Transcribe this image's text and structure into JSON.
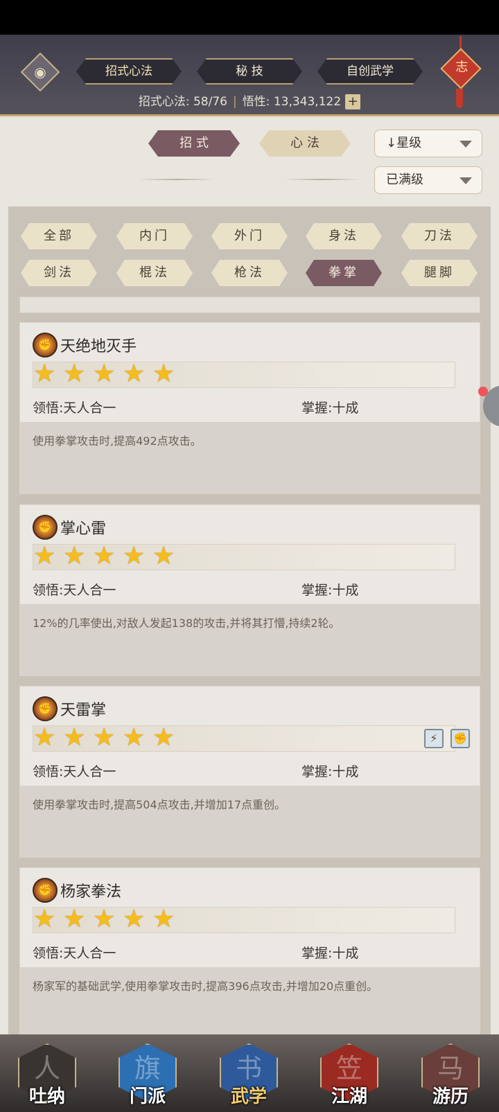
{
  "header": {
    "tabs": [
      {
        "label": "招式心法",
        "active": true
      },
      {
        "label": "秘 技",
        "active": false
      },
      {
        "label": "自创武学",
        "active": false
      }
    ],
    "stats": {
      "learned_label": "招式心法: 58/76",
      "insight_label": "悟性: 13,343,122"
    },
    "knot_char": "志"
  },
  "toggle": {
    "zhaoshi": "招 式",
    "xinfa": "心 法"
  },
  "sort": {
    "star_label": "↓星级",
    "filter_label": "已满级"
  },
  "filters": [
    "全部",
    "内门",
    "外门",
    "身法",
    "刀法",
    "剑法",
    "棍法",
    "枪法",
    "拳掌",
    "腿脚"
  ],
  "active_filter_index": 8,
  "cards": [
    {
      "name": "天绝地灭手",
      "stars": 5,
      "wu": "领悟:天人合一",
      "zhang": "掌握:十成",
      "desc": "使用拳掌攻击时,提高492点攻击。",
      "badges": []
    },
    {
      "name": "掌心雷",
      "stars": 5,
      "wu": "领悟:天人合一",
      "zhang": "掌握:十成",
      "desc": "12%的几率使出,对敌人发起138的攻击,并将其打懵,持续2轮。",
      "badges": []
    },
    {
      "name": "天雷掌",
      "stars": 5,
      "wu": "领悟:天人合一",
      "zhang": "掌握:十成",
      "desc": "使用拳掌攻击时,提高504点攻击,并增加17点重创。",
      "badges": [
        "⚡",
        "✊"
      ]
    },
    {
      "name": "杨家拳法",
      "stars": 5,
      "wu": "领悟:天人合一",
      "zhang": "掌握:十成",
      "desc": "杨家军的基础武学,使用拳掌攻击时,提高396点攻击,并增加20点重创。",
      "badges": []
    }
  ],
  "nav": [
    {
      "label": "吐纳",
      "icon": "meditate-icon",
      "glyph": "人",
      "color": "#3a3430",
      "active": false
    },
    {
      "label": "门派",
      "icon": "sect-icon",
      "glyph": "旗",
      "color": "#2d6fb3",
      "active": false
    },
    {
      "label": "武学",
      "icon": "book-icon",
      "glyph": "书",
      "color": "#2e5a9c",
      "active": true
    },
    {
      "label": "江湖",
      "icon": "hat-icon",
      "glyph": "笠",
      "color": "#9a2a22",
      "active": false
    },
    {
      "label": "游历",
      "icon": "horse-icon",
      "glyph": "马",
      "color": "#6a3e3a",
      "active": false
    }
  ]
}
